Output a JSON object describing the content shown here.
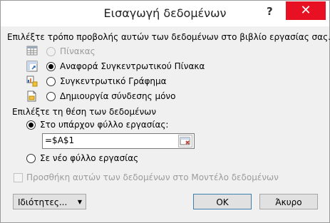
{
  "dialog": {
    "title": "Εισαγωγή δεδομένων",
    "help_label": "?",
    "close_label": "✕"
  },
  "view": {
    "heading": "Επιλέξτε τρόπο προβολής αυτών των δεδομένων στο βιβλίο εργασίας σας.",
    "options": [
      {
        "label": "Πίνακας",
        "checked": false,
        "disabled": true,
        "icon": "table-icon"
      },
      {
        "label": "Αναφορά Συγκεντρωτικού Πίνακα",
        "checked": true,
        "disabled": false,
        "icon": "pivottable-icon"
      },
      {
        "label": "Συγκεντρωτικό Γράφημα",
        "checked": false,
        "disabled": false,
        "icon": "pivotchart-icon"
      },
      {
        "label": "Δημιουργία σύνδεσης μόνο",
        "checked": false,
        "disabled": false,
        "icon": "connection-only-icon"
      }
    ]
  },
  "location": {
    "heading": "Επιλέξτε τη θέση των δεδομένων",
    "existing_label": "Στο υπάρχον φύλλο εργασίας:",
    "existing_checked": true,
    "range_value": "=$A$1",
    "new_label": "Σε νέο φύλλο εργασίας",
    "new_checked": false
  },
  "data_model": {
    "label": "Προσθήκη αυτών των δεδομένων στο Μοντέλο δεδομένων",
    "checked": false,
    "disabled": true
  },
  "buttons": {
    "properties": "Ιδιότητες...",
    "ok": "OK",
    "cancel": "Άκυρο"
  }
}
